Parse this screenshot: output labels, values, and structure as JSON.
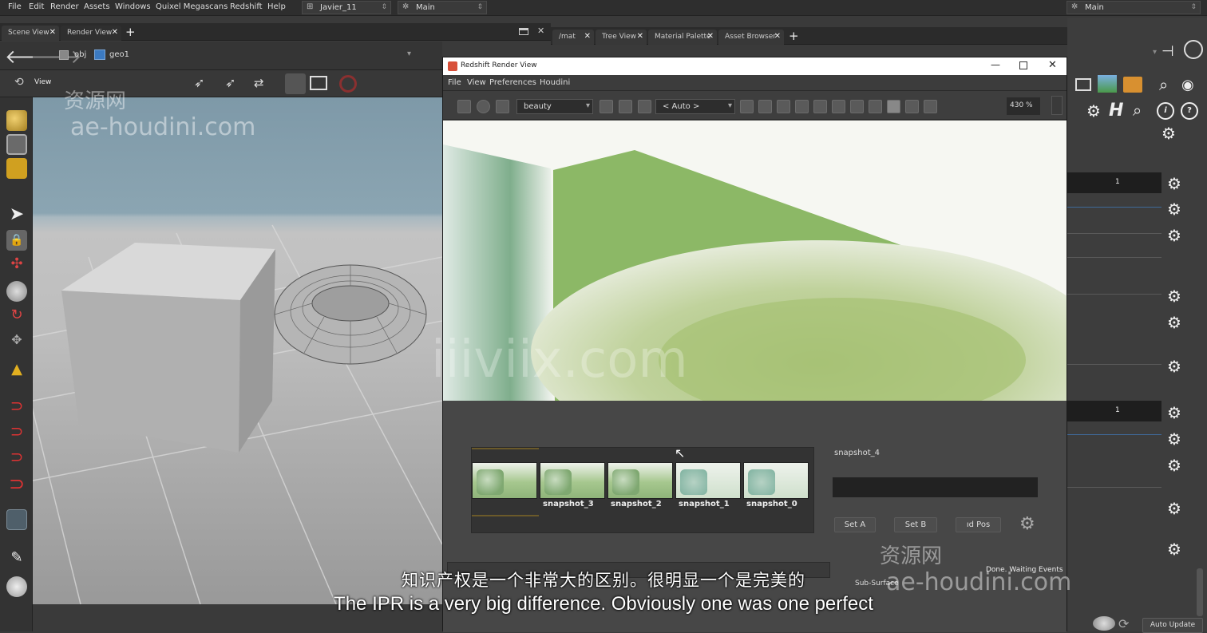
{
  "menubar": {
    "items": [
      "File",
      "Edit",
      "Render",
      "Assets",
      "Windows",
      "Quixel Megascans",
      "Redshift",
      "Help"
    ],
    "desktop": "Javier_11",
    "context": "Main",
    "right_context": "Main"
  },
  "left_pane": {
    "tabs": [
      "Scene View",
      "Render View"
    ],
    "path": [
      "obj",
      "geo1"
    ],
    "view_label": "View"
  },
  "right_tabs": [
    "/mat",
    "Tree View",
    "Material Palette",
    "Asset Browser"
  ],
  "render_view": {
    "title": "Redshift Render View",
    "menu": [
      "File",
      "View",
      "Preferences",
      "Houdini"
    ],
    "aov": "beauty",
    "camera": "< Auto >",
    "zoom": "430 %",
    "snapshots": [
      "",
      "snapshot_3",
      "snapshot_2",
      "snapshot_1",
      "snapshot_0"
    ],
    "selected_snapshot": "snapshot_4",
    "buttons": [
      "Set A",
      "Set B",
      "ıd Pos"
    ],
    "status": "Done. Waiting Events",
    "subsurface_label": "Sub-Surface"
  },
  "right_panel": {
    "field1": "1",
    "field2": "1",
    "bottom_button": "Auto Update"
  },
  "subtitles": {
    "cn": "知识产权是一个非常大的区别。很明显一个是完美的",
    "en": "The IPR is a very big difference. Obviously one was one perfect"
  },
  "watermarks": {
    "site_cn": "资源网",
    "site_url": "ae-houdini.com",
    "center": "iiiviix.com"
  }
}
